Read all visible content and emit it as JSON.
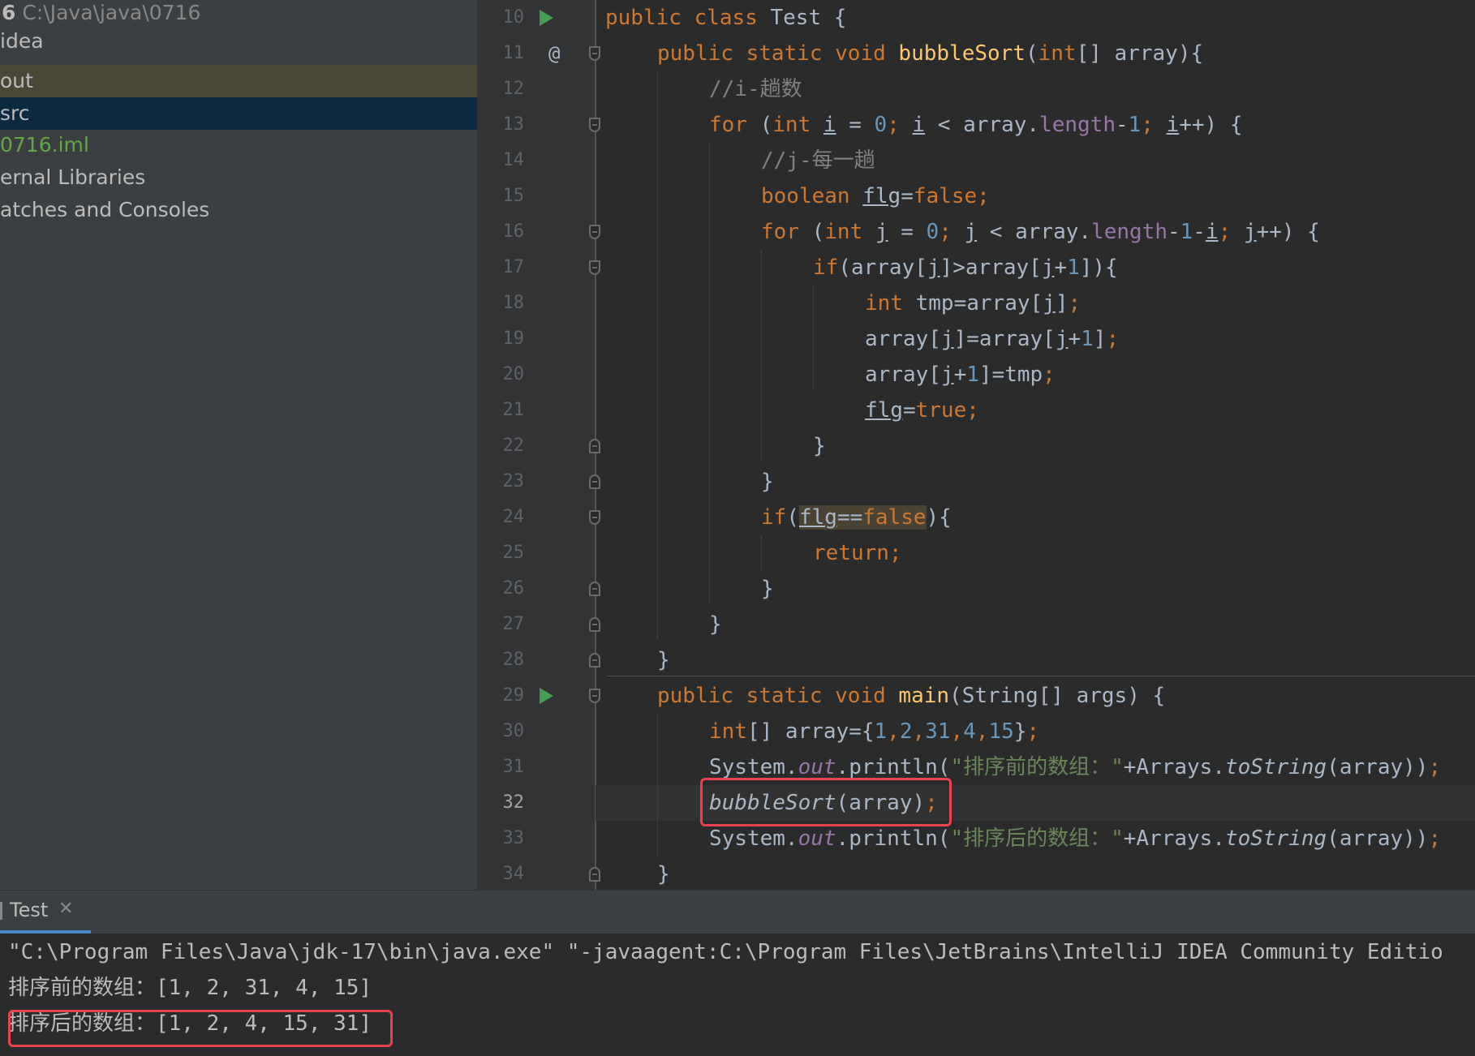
{
  "project_tree": {
    "root_name": "6",
    "root_path": "C:\\Java\\java\\0716",
    "items": [
      {
        "label": "idea"
      },
      {
        "label": "out"
      },
      {
        "label": "src"
      },
      {
        "label": "0716.iml"
      },
      {
        "label": "ernal Libraries"
      },
      {
        "label": "atches and Consoles"
      }
    ]
  },
  "editor": {
    "current_line": "32",
    "line_numbers": [
      "10",
      "11",
      "12",
      "13",
      "14",
      "15",
      "16",
      "17",
      "18",
      "19",
      "20",
      "21",
      "22",
      "23",
      "24",
      "25",
      "26",
      "27",
      "28",
      "29",
      "30",
      "31",
      "32",
      "33",
      "34"
    ],
    "code": {
      "l10_a": "public class ",
      "l10_b": "Test {",
      "l11_a": "public static void ",
      "l11_fn": "bubbleSort",
      "l11_b": "(",
      "l11_kw": "int",
      "l11_c": "[] array){",
      "l12": "//i-趟数",
      "l13_a": "for ",
      "l13_b": "(",
      "l13_kw": "int ",
      "l13_i1": "i",
      "l13_c": " = ",
      "l13_n0": "0",
      "l13_s1": "; ",
      "l13_i2": "i",
      "l13_d": " < array.",
      "l13_len": "length",
      "l13_e": "-",
      "l13_n1": "1",
      "l13_s2": "; ",
      "l13_i3": "i",
      "l13_f": "++) {",
      "l14": "//j-每一趟",
      "l15_kw": "boolean ",
      "l15_v": "flg",
      "l15_a": "=",
      "l15_false": "false",
      "l15_s": ";",
      "l16_a": "for ",
      "l16_b": "(",
      "l16_kw": "int ",
      "l16_j1": "j",
      "l16_c": " = ",
      "l16_n0": "0",
      "l16_s1": "; ",
      "l16_j2": "j",
      "l16_d": " < array.",
      "l16_len": "length",
      "l16_e": "-",
      "l16_n1": "1",
      "l16_f": "-",
      "l16_i": "i",
      "l16_s2": "; ",
      "l16_j3": "j",
      "l16_g": "++) {",
      "l17_kw": "if",
      "l17_a": "(array[",
      "l17_j1": "j",
      "l17_b": "]>array[",
      "l17_j2": "j",
      "l17_c": "+",
      "l17_n1": "1",
      "l17_d": "]){",
      "l18_kw": "int ",
      "l18_a": "tmp=array[",
      "l18_j": "j",
      "l18_b": "]",
      "l18_s": ";",
      "l19_a": "array[",
      "l19_j1": "j",
      "l19_b": "]=array[",
      "l19_j2": "j",
      "l19_c": "+",
      "l19_n1": "1",
      "l19_d": "]",
      "l19_s": ";",
      "l20_a": "array[",
      "l20_j": "j",
      "l20_b": "+",
      "l20_n1": "1",
      "l20_c": "]=tmp",
      "l20_s": ";",
      "l21_v": "flg",
      "l21_a": "=",
      "l21_true": "true",
      "l21_s": ";",
      "l22": "}",
      "l23": "}",
      "l24_kw": "if",
      "l24_a": "(",
      "l24_v": "flg",
      "l24_b": "==",
      "l24_false": "false",
      "l24_c": "){",
      "l25_kw": "return",
      "l25_s": ";",
      "l26": "}",
      "l27": "}",
      "l28": "}",
      "l29_a": "public static void ",
      "l29_fn": "main",
      "l29_b": "(String[] args) {",
      "l30_kw": "int",
      "l30_a": "[] array={",
      "l30_n1": "1",
      "l30_c1": ",",
      "l30_n2": "2",
      "l30_c2": ",",
      "l30_n3": "31",
      "l30_c3": ",",
      "l30_n4": "4",
      "l30_c4": ",",
      "l30_n5": "15",
      "l30_b": "}",
      "l30_s": ";",
      "l31_a": "System.",
      "l31_out": "out",
      "l31_b": ".println(",
      "l31_str": "\"排序前的数组：\"",
      "l31_c": "+Arrays.",
      "l31_ts": "toString",
      "l31_d": "(array))",
      "l31_s": ";",
      "l32_fn": "bubbleSort",
      "l32_a": "(array)",
      "l32_s": ";",
      "l33_a": "System.",
      "l33_out": "out",
      "l33_b": ".println(",
      "l33_str": "\"排序后的数组：\"",
      "l33_c": "+Arrays.",
      "l33_ts": "toString",
      "l33_d": "(array))",
      "l33_s": ";",
      "l34": "}"
    }
  },
  "run_panel": {
    "tab_label": "Test",
    "close_glyph": "✕",
    "console_lines": [
      "\"C:\\Program Files\\Java\\jdk-17\\bin\\java.exe\" \"-javaagent:C:\\Program Files\\JetBrains\\IntelliJ IDEA Community Editio",
      "排序前的数组：[1, 2, 31, 4, 15]",
      "排序后的数组：[1, 2, 4, 15, 31]"
    ]
  },
  "colors": {
    "keyword": "#cc7832",
    "number": "#6897bb",
    "string": "#6a8759",
    "comment": "#808080",
    "method": "#ffc66d",
    "field": "#9876aa",
    "highlight_box": "#e8434e",
    "run_icon": "#499c54"
  }
}
